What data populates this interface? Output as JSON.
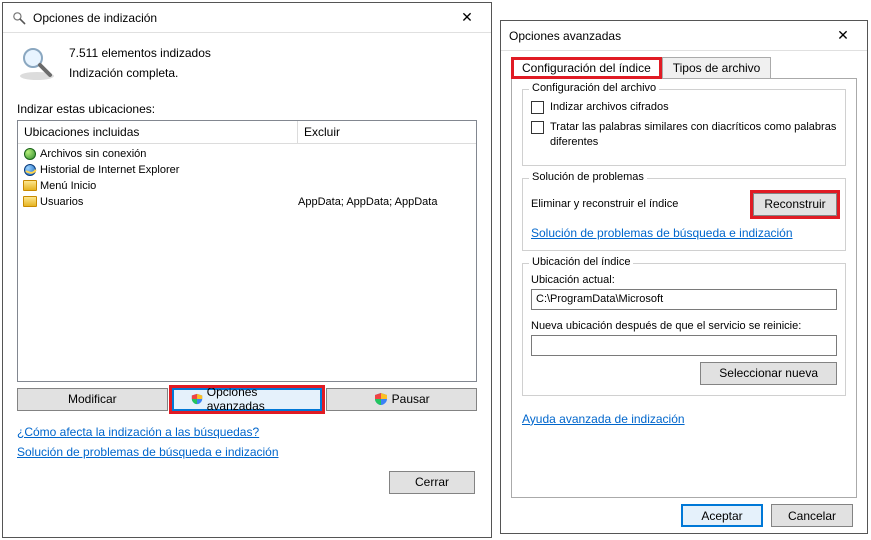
{
  "d1": {
    "title": "Opciones de indización",
    "status_count": "7.511 elementos indizados",
    "status_text": "Indización completa.",
    "loc_label": "Indizar estas ubicaciones:",
    "col_included": "Ubicaciones incluidas",
    "col_exclude": "Excluir",
    "rows": [
      {
        "label": "Archivos sin conexión",
        "exclude": ""
      },
      {
        "label": "Historial de Internet Explorer",
        "exclude": ""
      },
      {
        "label": "Menú Inicio",
        "exclude": ""
      },
      {
        "label": "Usuarios",
        "exclude": "AppData; AppData; AppData"
      }
    ],
    "btn_modify": "Modificar",
    "btn_advanced": "Opciones avanzadas",
    "btn_pause": "Pausar",
    "link_how": "¿Cómo afecta la indización a las búsquedas?",
    "link_ts": "Solución de problemas de búsqueda e indización",
    "btn_close": "Cerrar"
  },
  "d2": {
    "title": "Opciones avanzadas",
    "tab_index": "Configuración del índice",
    "tab_types": "Tipos de archivo",
    "grp_file": "Configuración del archivo",
    "chk_encrypted": "Indizar archivos cifrados",
    "chk_diacritics": "Tratar las palabras similares con diacríticos como palabras diferentes",
    "grp_ts": "Solución de problemas",
    "ts_text": "Eliminar y reconstruir el índice",
    "btn_rebuild": "Reconstruir",
    "link_ts": "Solución de problemas de búsqueda e indización",
    "grp_loc": "Ubicación del índice",
    "loc_current": "Ubicación actual:",
    "loc_path": "C:\\ProgramData\\Microsoft",
    "loc_new": "Nueva ubicación después de que el servicio se reinicie:",
    "btn_selnew": "Seleccionar nueva",
    "link_help": "Ayuda avanzada de indización",
    "btn_ok": "Aceptar",
    "btn_cancel": "Cancelar"
  }
}
